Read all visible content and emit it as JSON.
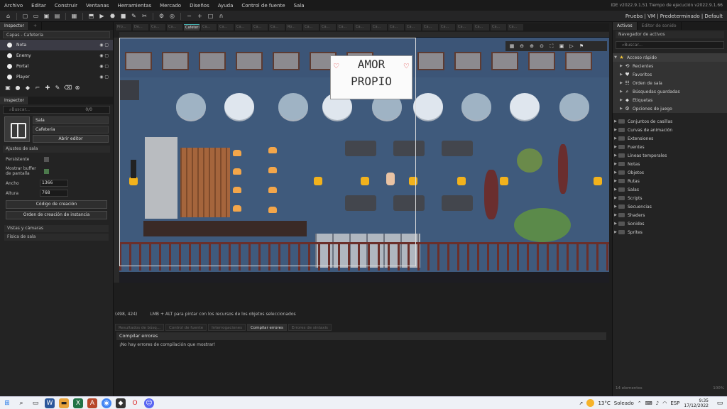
{
  "menu": {
    "items": [
      "Archivo",
      "Editar",
      "Construir",
      "Ventanas",
      "Herramientas",
      "Mercado",
      "Diseños",
      "Ayuda",
      "Control de fuente",
      "Sala"
    ],
    "version": "IDE v2022.9.1.51   Tiempo de ejecución v2022.9.1.66"
  },
  "toolbar": {
    "targets": "Prueba | VM | Predeterminado | Default"
  },
  "left": {
    "tab": "Inspector",
    "layer_header": "Capas - Cafetería",
    "layers": [
      {
        "label": "Nota"
      },
      {
        "label": "Enemy"
      },
      {
        "label": "Portal"
      },
      {
        "label": "Player"
      }
    ],
    "inspector_tab": "Inspector",
    "search_placeholder": "Buscar...",
    "search_count": "0/0",
    "room_type": "Sala",
    "room_name": "Cafeteria",
    "open_editor": "Abrir editor",
    "settings_header": "Ajustes de sala",
    "persistent_label": "Persistente",
    "clear_buffer_label": "Mostrar buffer de pantalla",
    "width_label": "Ancho",
    "width_value": "1366",
    "height_label": "Altura",
    "height_value": "768",
    "creation_code": "Código de creación",
    "instance_order": "Orden de creación de instancia",
    "views_header": "Vistas y cámaras",
    "physics_header": "Física de sala"
  },
  "editor": {
    "tab_labels": [
      "Pro...",
      "De...",
      "Ca...",
      "Ca...",
      "Cafetería",
      "Ca...",
      "Ca...",
      "Ca...",
      "Ca...",
      "Ca...",
      "Ro...",
      "Ca...",
      "Ca...",
      "Ca...",
      "Ca...",
      "Ca...",
      "Ca...",
      "Ca...",
      "Ca...",
      "Ca...",
      "Ca...",
      "Ca...",
      "Ca...",
      "Ca..."
    ],
    "sign_line1": "AMOR",
    "sign_line2": "PROPIO",
    "coords": "(498, 424)",
    "hint": "LMB + ALT para pintar con los recursos de los objetos seleccionados"
  },
  "output": {
    "tabs": [
      "Resultados de búsq...",
      "Control de fuente",
      "Interrogaciones",
      "Compilar errores",
      "Errores de sintaxis"
    ],
    "active_tab": "Compilar errores",
    "header": "Compilar errores",
    "message": "¡No hay errores de compilación que mostrar!"
  },
  "assets": {
    "tabs": [
      "Activos",
      "Editor de sonido"
    ],
    "header": "Navegador de activos",
    "search_placeholder": "Buscar...",
    "quick_access": "Acceso rápido",
    "quick_items": [
      "Recientes",
      "Favoritos",
      "Orden de sala",
      "Búsquedas guardadas",
      "Etiquetas",
      "Opciones de juego"
    ],
    "folders": [
      "Conjuntos de casillas",
      "Curvas de animación",
      "Extensiones",
      "Fuentes",
      "Líneas temporales",
      "Notas",
      "Objetos",
      "Rutas",
      "Salas",
      "Scripts",
      "Secuencias",
      "Shaders",
      "Sonidos",
      "Sprites"
    ],
    "footer_left": "14 elementos",
    "footer_right": "100%"
  },
  "taskbar": {
    "temp": "13°C",
    "weather": "Soleado",
    "lang": "ESP",
    "time": "9:35",
    "date": "17/12/2022"
  }
}
